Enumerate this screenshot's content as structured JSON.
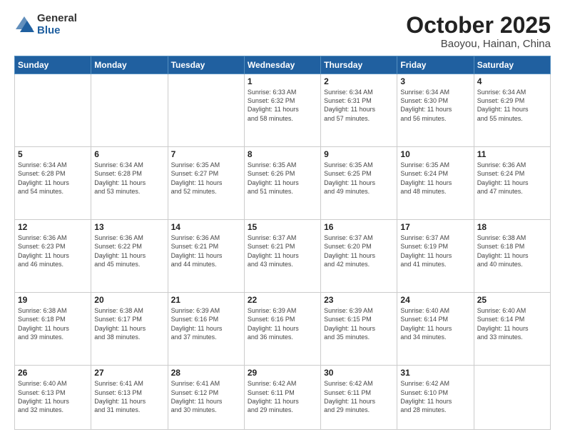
{
  "logo": {
    "general": "General",
    "blue": "Blue"
  },
  "title": "October 2025",
  "subtitle": "Baoyou, Hainan, China",
  "days_of_week": [
    "Sunday",
    "Monday",
    "Tuesday",
    "Wednesday",
    "Thursday",
    "Friday",
    "Saturday"
  ],
  "weeks": [
    [
      {
        "day": "",
        "info": ""
      },
      {
        "day": "",
        "info": ""
      },
      {
        "day": "",
        "info": ""
      },
      {
        "day": "1",
        "info": "Sunrise: 6:33 AM\nSunset: 6:32 PM\nDaylight: 11 hours\nand 58 minutes."
      },
      {
        "day": "2",
        "info": "Sunrise: 6:34 AM\nSunset: 6:31 PM\nDaylight: 11 hours\nand 57 minutes."
      },
      {
        "day": "3",
        "info": "Sunrise: 6:34 AM\nSunset: 6:30 PM\nDaylight: 11 hours\nand 56 minutes."
      },
      {
        "day": "4",
        "info": "Sunrise: 6:34 AM\nSunset: 6:29 PM\nDaylight: 11 hours\nand 55 minutes."
      }
    ],
    [
      {
        "day": "5",
        "info": "Sunrise: 6:34 AM\nSunset: 6:28 PM\nDaylight: 11 hours\nand 54 minutes."
      },
      {
        "day": "6",
        "info": "Sunrise: 6:34 AM\nSunset: 6:28 PM\nDaylight: 11 hours\nand 53 minutes."
      },
      {
        "day": "7",
        "info": "Sunrise: 6:35 AM\nSunset: 6:27 PM\nDaylight: 11 hours\nand 52 minutes."
      },
      {
        "day": "8",
        "info": "Sunrise: 6:35 AM\nSunset: 6:26 PM\nDaylight: 11 hours\nand 51 minutes."
      },
      {
        "day": "9",
        "info": "Sunrise: 6:35 AM\nSunset: 6:25 PM\nDaylight: 11 hours\nand 49 minutes."
      },
      {
        "day": "10",
        "info": "Sunrise: 6:35 AM\nSunset: 6:24 PM\nDaylight: 11 hours\nand 48 minutes."
      },
      {
        "day": "11",
        "info": "Sunrise: 6:36 AM\nSunset: 6:24 PM\nDaylight: 11 hours\nand 47 minutes."
      }
    ],
    [
      {
        "day": "12",
        "info": "Sunrise: 6:36 AM\nSunset: 6:23 PM\nDaylight: 11 hours\nand 46 minutes."
      },
      {
        "day": "13",
        "info": "Sunrise: 6:36 AM\nSunset: 6:22 PM\nDaylight: 11 hours\nand 45 minutes."
      },
      {
        "day": "14",
        "info": "Sunrise: 6:36 AM\nSunset: 6:21 PM\nDaylight: 11 hours\nand 44 minutes."
      },
      {
        "day": "15",
        "info": "Sunrise: 6:37 AM\nSunset: 6:21 PM\nDaylight: 11 hours\nand 43 minutes."
      },
      {
        "day": "16",
        "info": "Sunrise: 6:37 AM\nSunset: 6:20 PM\nDaylight: 11 hours\nand 42 minutes."
      },
      {
        "day": "17",
        "info": "Sunrise: 6:37 AM\nSunset: 6:19 PM\nDaylight: 11 hours\nand 41 minutes."
      },
      {
        "day": "18",
        "info": "Sunrise: 6:38 AM\nSunset: 6:18 PM\nDaylight: 11 hours\nand 40 minutes."
      }
    ],
    [
      {
        "day": "19",
        "info": "Sunrise: 6:38 AM\nSunset: 6:18 PM\nDaylight: 11 hours\nand 39 minutes."
      },
      {
        "day": "20",
        "info": "Sunrise: 6:38 AM\nSunset: 6:17 PM\nDaylight: 11 hours\nand 38 minutes."
      },
      {
        "day": "21",
        "info": "Sunrise: 6:39 AM\nSunset: 6:16 PM\nDaylight: 11 hours\nand 37 minutes."
      },
      {
        "day": "22",
        "info": "Sunrise: 6:39 AM\nSunset: 6:16 PM\nDaylight: 11 hours\nand 36 minutes."
      },
      {
        "day": "23",
        "info": "Sunrise: 6:39 AM\nSunset: 6:15 PM\nDaylight: 11 hours\nand 35 minutes."
      },
      {
        "day": "24",
        "info": "Sunrise: 6:40 AM\nSunset: 6:14 PM\nDaylight: 11 hours\nand 34 minutes."
      },
      {
        "day": "25",
        "info": "Sunrise: 6:40 AM\nSunset: 6:14 PM\nDaylight: 11 hours\nand 33 minutes."
      }
    ],
    [
      {
        "day": "26",
        "info": "Sunrise: 6:40 AM\nSunset: 6:13 PM\nDaylight: 11 hours\nand 32 minutes."
      },
      {
        "day": "27",
        "info": "Sunrise: 6:41 AM\nSunset: 6:13 PM\nDaylight: 11 hours\nand 31 minutes."
      },
      {
        "day": "28",
        "info": "Sunrise: 6:41 AM\nSunset: 6:12 PM\nDaylight: 11 hours\nand 30 minutes."
      },
      {
        "day": "29",
        "info": "Sunrise: 6:42 AM\nSunset: 6:11 PM\nDaylight: 11 hours\nand 29 minutes."
      },
      {
        "day": "30",
        "info": "Sunrise: 6:42 AM\nSunset: 6:11 PM\nDaylight: 11 hours\nand 29 minutes."
      },
      {
        "day": "31",
        "info": "Sunrise: 6:42 AM\nSunset: 6:10 PM\nDaylight: 11 hours\nand 28 minutes."
      },
      {
        "day": "",
        "info": ""
      }
    ]
  ]
}
